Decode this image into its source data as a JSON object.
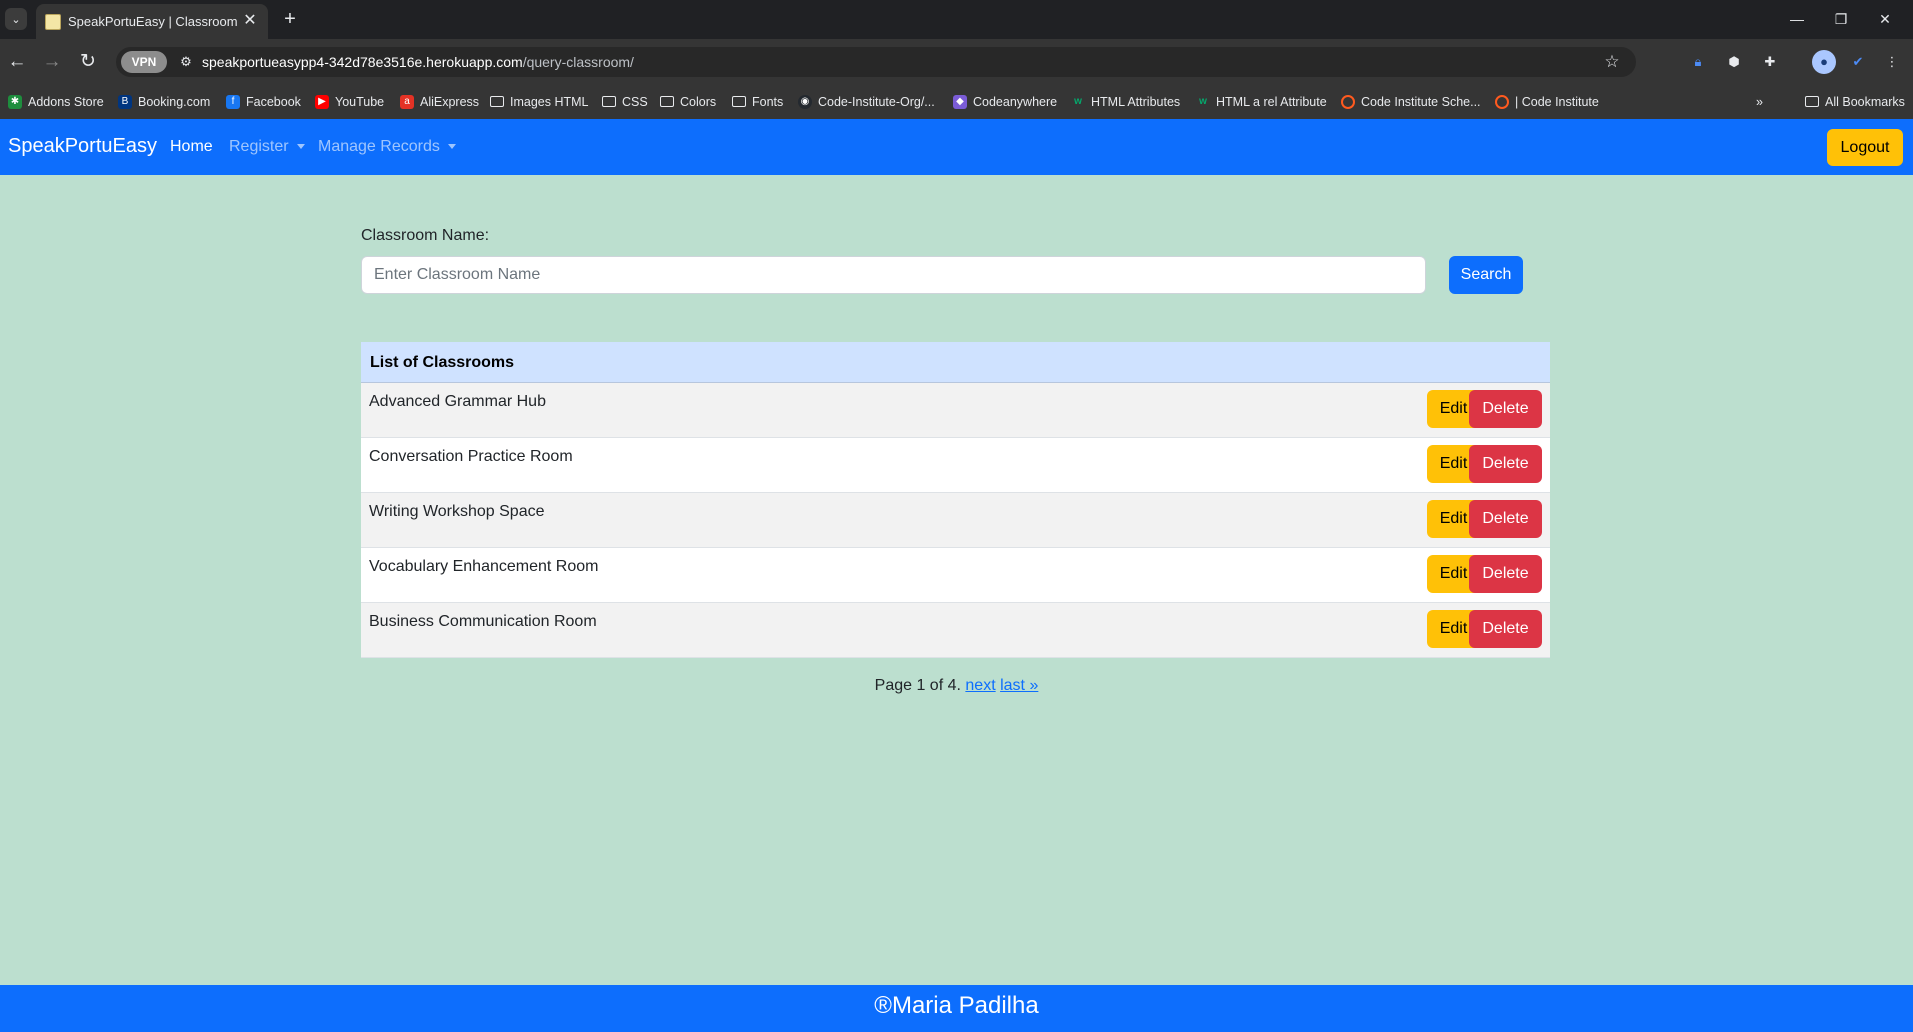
{
  "browser": {
    "tab_title": "SpeakPortuEasy | Classroom Qu",
    "vpn_label": "VPN",
    "url_host": "speakportueasypp4-342d78e3516e.herokuapp.com",
    "url_path": "/query-classroom/",
    "bookmarks": [
      {
        "label": "Addons Store",
        "icon": "puzzle-icon"
      },
      {
        "label": "Booking.com",
        "icon": "booking-icon"
      },
      {
        "label": "Facebook",
        "icon": "facebook-icon"
      },
      {
        "label": "YouTube",
        "icon": "youtube-icon"
      },
      {
        "label": "AliExpress",
        "icon": "aliexpress-icon"
      },
      {
        "label": "Images HTML",
        "icon": "folder-icon"
      },
      {
        "label": "CSS",
        "icon": "folder-icon"
      },
      {
        "label": "Colors",
        "icon": "folder-icon"
      },
      {
        "label": "Fonts",
        "icon": "folder-icon"
      },
      {
        "label": "Code-Institute-Org/...",
        "icon": "github-icon"
      },
      {
        "label": "Codeanywhere",
        "icon": "codeanywhere-icon"
      },
      {
        "label": "HTML Attributes",
        "icon": "w3-icon"
      },
      {
        "label": "HTML a rel Attribute",
        "icon": "w3-icon"
      },
      {
        "label": "Code Institute Sche...",
        "icon": "code-institute-icon"
      },
      {
        "label": "| Code Institute",
        "icon": "code-institute-icon"
      }
    ],
    "all_bookmarks": "All Bookmarks"
  },
  "navbar": {
    "brand": "SpeakPortuEasy",
    "home": "Home",
    "register": "Register",
    "manage_records": "Manage Records",
    "logout": "Logout"
  },
  "search": {
    "label": "Classroom Name:",
    "placeholder": "Enter Classroom Name",
    "button": "Search"
  },
  "table": {
    "header": "List of Classrooms",
    "edit_label": "Edit",
    "delete_label": "Delete",
    "rows": [
      "Advanced Grammar Hub",
      "Conversation Practice Room",
      "Writing Workshop Space",
      "Vocabulary Enhancement Room",
      "Business Communication Room"
    ]
  },
  "pagination": {
    "text": "Page 1 of 4.",
    "next": "next",
    "last": "last »"
  },
  "footer": {
    "text": "®Maria Padilha"
  },
  "colors": {
    "primary": "#0d6efd",
    "warning": "#ffc107",
    "danger": "#dc3545",
    "page_bg": "#bcdfcf",
    "table_header_bg": "#cfe2ff"
  }
}
